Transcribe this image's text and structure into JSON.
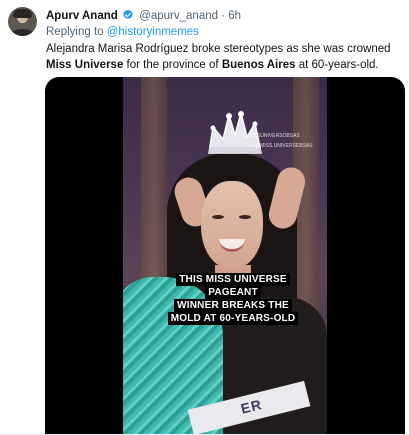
{
  "tweet": {
    "author_name": "Apurv Anand",
    "handle": "@apurv_anand",
    "separator": "·",
    "time": "6h",
    "replying_prefix": "Replying to ",
    "replying_to": "@historyinmemes",
    "text_part1": "Alejandra Marisa Rodríguez broke stereotypes as she was crowned ",
    "text_bold1": "Miss Universe",
    "text_part2": " for the province of ",
    "text_bold2": "Buenos Aires",
    "text_part3": " at 60-years-old."
  },
  "media": {
    "caption_line1": "THIS MISS UNIVERSE PAGEANT",
    "caption_line2": "WINNER BREAKS THE",
    "caption_line3": "MOLD AT 60-YEARS-OLD",
    "watermark1": "@MISSUNIVERSOBSAS",
    "watermark2": "@MISS.UNIVERSEBSAS",
    "sash_text": "ER"
  },
  "colors": {
    "link": "#1d9bf0",
    "verified": "#1d9bf0",
    "secondary_text": "#536471"
  },
  "icons": {
    "verified": "verified-badge-icon"
  }
}
